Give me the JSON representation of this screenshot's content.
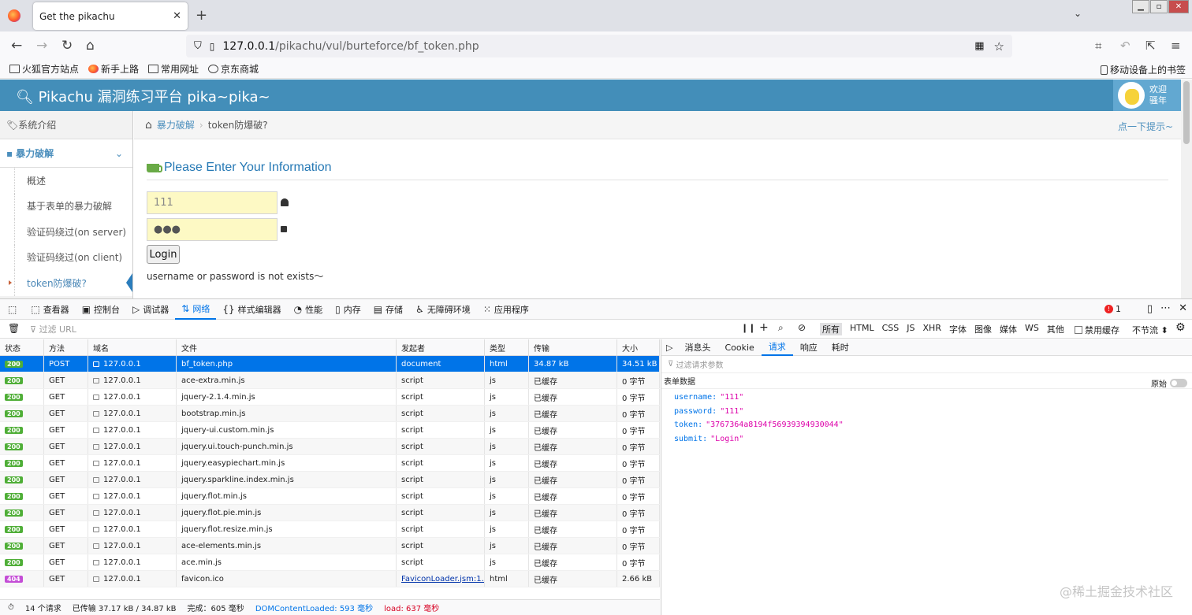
{
  "browser": {
    "tab_title": "Get the pikachu",
    "tab_close": "✕",
    "new_tab": "+",
    "url_host": "127.0.0.1",
    "url_path": "/pikachu/vul/burteforce/bf_token.php",
    "bookmarks": [
      "火狐官方站点",
      "新手上路",
      "常用网址",
      "京东商城"
    ],
    "mobile_bookmarks": "移动设备上的书签"
  },
  "site": {
    "brand": "Pikachu 漏洞练习平台 pika~pika~",
    "welcome": "欢迎",
    "username_label": "骚年",
    "sidebar": {
      "top_item": "系统介绍",
      "section": "暴力破解",
      "items": [
        "概述",
        "基于表单的暴力破解",
        "验证码绕过(on server)",
        "验证码绕过(on client)",
        "token防爆破?"
      ]
    },
    "breadcrumb": {
      "parent": "暴力破解",
      "current": "token防爆破?"
    },
    "hint": "点一下提示~",
    "form": {
      "title": "Please Enter Your Information",
      "username_value": "111",
      "password_value": "●●●",
      "login_label": "Login",
      "message": "username or password is not exists～"
    }
  },
  "devtools": {
    "tabs": [
      {
        "icon": "⬚",
        "label": "查看器"
      },
      {
        "icon": "▣",
        "label": "控制台"
      },
      {
        "icon": "▷",
        "label": "调试器"
      },
      {
        "icon": "⇅",
        "label": "网络"
      },
      {
        "icon": "{}",
        "label": "样式编辑器"
      },
      {
        "icon": "◔",
        "label": "性能"
      },
      {
        "icon": "▯",
        "label": "内存"
      },
      {
        "icon": "▤",
        "label": "存储"
      },
      {
        "icon": "♿",
        "label": "无障碍环境"
      },
      {
        "icon": "⁙",
        "label": "应用程序"
      }
    ],
    "error_count": "1",
    "filter_placeholder": "过滤 URL",
    "filter_types": [
      "所有",
      "HTML",
      "CSS",
      "JS",
      "XHR",
      "字体",
      "图像",
      "媒体",
      "WS",
      "其他"
    ],
    "disable_cache": "禁用缓存",
    "throttle": "不节流 ⬍",
    "columns": [
      "状态",
      "方法",
      "域名",
      "文件",
      "发起者",
      "类型",
      "传输",
      "大小"
    ],
    "requests": [
      {
        "status": "200",
        "method": "POST",
        "domain": "127.0.0.1",
        "file": "bf_token.php",
        "initiator": "document",
        "type": "html",
        "transfer": "34.87 kB",
        "size": "34.51 kB"
      },
      {
        "status": "200",
        "method": "GET",
        "domain": "127.0.0.1",
        "file": "ace-extra.min.js",
        "initiator": "script",
        "type": "js",
        "transfer": "已缓存",
        "size": "0 字节"
      },
      {
        "status": "200",
        "method": "GET",
        "domain": "127.0.0.1",
        "file": "jquery-2.1.4.min.js",
        "initiator": "script",
        "type": "js",
        "transfer": "已缓存",
        "size": "0 字节"
      },
      {
        "status": "200",
        "method": "GET",
        "domain": "127.0.0.1",
        "file": "bootstrap.min.js",
        "initiator": "script",
        "type": "js",
        "transfer": "已缓存",
        "size": "0 字节"
      },
      {
        "status": "200",
        "method": "GET",
        "domain": "127.0.0.1",
        "file": "jquery-ui.custom.min.js",
        "initiator": "script",
        "type": "js",
        "transfer": "已缓存",
        "size": "0 字节"
      },
      {
        "status": "200",
        "method": "GET",
        "domain": "127.0.0.1",
        "file": "jquery.ui.touch-punch.min.js",
        "initiator": "script",
        "type": "js",
        "transfer": "已缓存",
        "size": "0 字节"
      },
      {
        "status": "200",
        "method": "GET",
        "domain": "127.0.0.1",
        "file": "jquery.easypiechart.min.js",
        "initiator": "script",
        "type": "js",
        "transfer": "已缓存",
        "size": "0 字节"
      },
      {
        "status": "200",
        "method": "GET",
        "domain": "127.0.0.1",
        "file": "jquery.sparkline.index.min.js",
        "initiator": "script",
        "type": "js",
        "transfer": "已缓存",
        "size": "0 字节"
      },
      {
        "status": "200",
        "method": "GET",
        "domain": "127.0.0.1",
        "file": "jquery.flot.min.js",
        "initiator": "script",
        "type": "js",
        "transfer": "已缓存",
        "size": "0 字节"
      },
      {
        "status": "200",
        "method": "GET",
        "domain": "127.0.0.1",
        "file": "jquery.flot.pie.min.js",
        "initiator": "script",
        "type": "js",
        "transfer": "已缓存",
        "size": "0 字节"
      },
      {
        "status": "200",
        "method": "GET",
        "domain": "127.0.0.1",
        "file": "jquery.flot.resize.min.js",
        "initiator": "script",
        "type": "js",
        "transfer": "已缓存",
        "size": "0 字节"
      },
      {
        "status": "200",
        "method": "GET",
        "domain": "127.0.0.1",
        "file": "ace-elements.min.js",
        "initiator": "script",
        "type": "js",
        "transfer": "已缓存",
        "size": "0 字节"
      },
      {
        "status": "200",
        "method": "GET",
        "domain": "127.0.0.1",
        "file": "ace.min.js",
        "initiator": "script",
        "type": "js",
        "transfer": "已缓存",
        "size": "0 字节"
      },
      {
        "status": "404",
        "method": "GET",
        "domain": "127.0.0.1",
        "file": "favicon.ico",
        "initiator": "FaviconLoader.jsm:1...",
        "type": "html",
        "transfer": "已缓存",
        "size": "2.66 kB"
      }
    ],
    "status_bar": {
      "requests": "14 个请求",
      "transferred": "已传输 37.17 kB / 34.87 kB",
      "finish": "完成：605 毫秒",
      "dcl": "DOMContentLoaded: 593 毫秒",
      "load": "load: 637 毫秒"
    },
    "panel_tabs": [
      "消息头",
      "Cookie",
      "请求",
      "响应",
      "耗时"
    ],
    "panel_filter": "过滤请求参数",
    "form_data_label": "表单数据",
    "raw_label": "原始",
    "params": [
      {
        "key": "username:",
        "value": "\"111\""
      },
      {
        "key": "password:",
        "value": "\"111\""
      },
      {
        "key": "token:",
        "value": "\"3767364a8194f56939394930044\""
      },
      {
        "key": "submit:",
        "value": "\"Login\""
      }
    ]
  },
  "watermark": "@稀土掘金技术社区"
}
